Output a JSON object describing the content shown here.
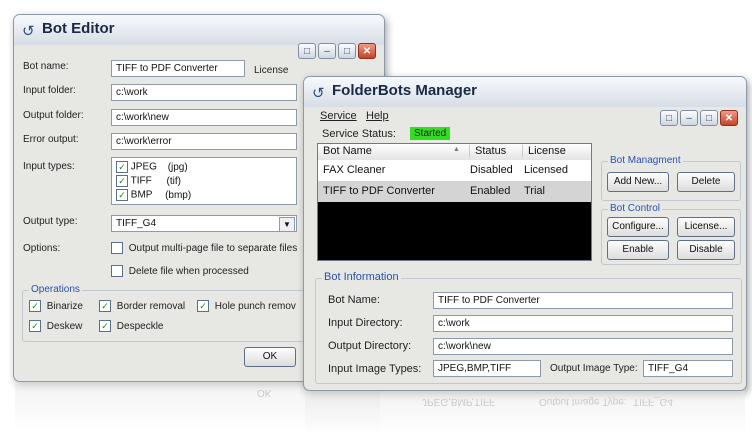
{
  "bot_editor": {
    "title": "Bot Editor",
    "bot_name_label": "Bot name:",
    "bot_name_value": "TIFF to PDF Converter",
    "license_label": "License",
    "input_folder_label": "Input folder:",
    "input_folder_value": "c:\\work",
    "output_folder_label": "Output folder:",
    "output_folder_value": "c:\\work\\new",
    "error_output_label": "Error output:",
    "error_output_value": "c:\\work\\error",
    "input_types_label": "Input types:",
    "input_types": [
      {
        "name": "JPEG",
        "ext": "(jpg)"
      },
      {
        "name": "TIFF",
        "ext": "(tif)"
      },
      {
        "name": "BMP",
        "ext": "(bmp)"
      }
    ],
    "output_type_label": "Output type:",
    "output_type_value": "TIFF_G4",
    "options_label": "Options:",
    "option_multipage": "Output multi-page file to separate files",
    "option_delete": "Delete file when processed",
    "operations_title": "Operations",
    "op_binarize": "Binarize",
    "op_border_removal": "Border removal",
    "op_hole_punch": "Hole punch remov",
    "op_deskew": "Deskew",
    "op_despeckle": "Despeckle",
    "ok_label": "OK"
  },
  "manager": {
    "title": "FolderBots Manager",
    "menu_service": "Service",
    "menu_help": "Help",
    "service_status_label": "Service Status:",
    "service_status_value": "Started",
    "table_headers": [
      "Bot Name",
      "Status",
      "License"
    ],
    "rows": [
      {
        "name": "FAX Cleaner",
        "status": "Disabled",
        "license": "Licensed"
      },
      {
        "name": "TIFF to PDF Converter",
        "status": "Enabled",
        "license": "Trial"
      }
    ],
    "bot_management_title": "Bot Managment",
    "add_new": "Add New...",
    "delete": "Delete",
    "bot_control_title": "Bot Control",
    "configure": "Configure...",
    "license": "License...",
    "enable": "Enable",
    "disable": "Disable",
    "bot_info_title": "Bot Information",
    "bot_name_label": "Bot Name:",
    "bot_name_value": "TIFF to PDF Converter",
    "input_dir_label": "Input Directory:",
    "input_dir_value": "c:\\work",
    "output_dir_label": "Output Directory:",
    "output_dir_value": "c:\\work\\new",
    "input_types_label": "Input Image Types:",
    "input_types_value": "JPEG,BMP,TIFF",
    "output_type_label": "Output Image Type:",
    "output_type_value": "TIFF_G4"
  },
  "colors": {
    "status_started": "#33dd22",
    "selected_row": "#d4d4d4",
    "empty_list": "#000000",
    "group_title": "#2a53a8"
  }
}
